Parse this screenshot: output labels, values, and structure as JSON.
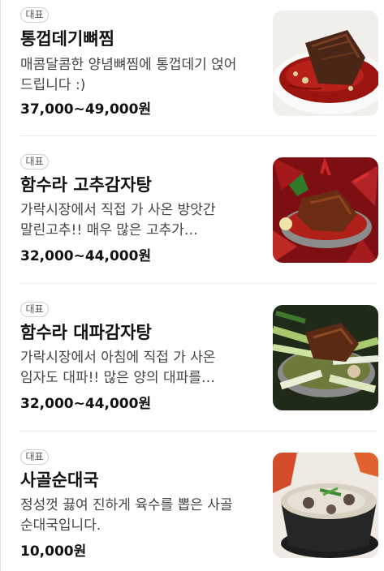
{
  "badge_label": "대표",
  "items": [
    {
      "name": "통껍데기뼈찜",
      "description": "매콤달콤한 양념뼈찜에 통껍데기 얹어 드립니다 :)",
      "price": "37,000~49,000원"
    },
    {
      "name": "함수라 고추감자탕",
      "description": "가락시장에서 직접 가 사온 방앗간 말린고추!! 매우 많은 고추가 들어갑니다!",
      "price": "32,000~44,000원"
    },
    {
      "name": "함수라 대파감자탕",
      "description": "가락시장에서 아침에 직접 가 사온 임자도 대파!! 많은 양의 대파를 넣어드립니다",
      "price": "32,000~44,000원"
    },
    {
      "name": "사골순대국",
      "description": "정성껏 끓여 진하게 육수를 뽑은 사골 순대국입니다.",
      "price": "10,000원"
    }
  ]
}
